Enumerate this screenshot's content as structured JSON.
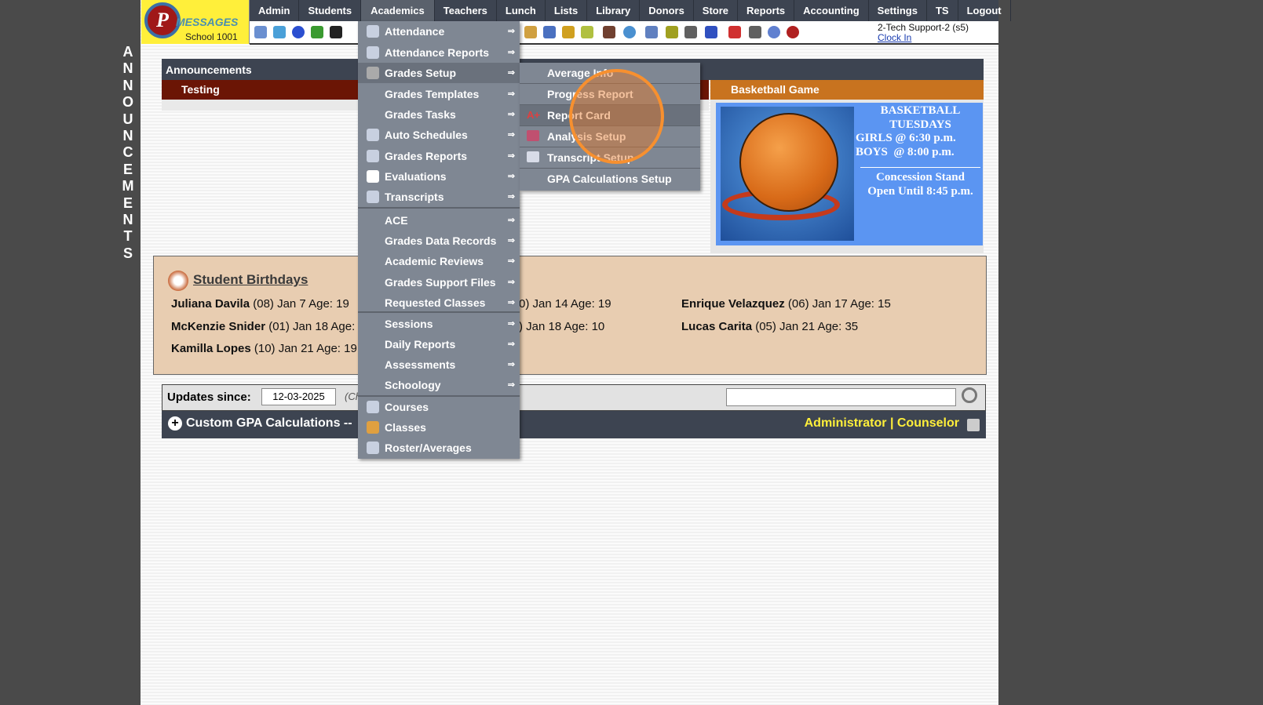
{
  "sidebar_vertical": "ANNOUNCEMENTS",
  "logo": {
    "letters": "P",
    "brand": "MESSAGES",
    "school": "School 1001"
  },
  "nav": [
    "Admin",
    "Students",
    "Academics",
    "Teachers",
    "Lunch",
    "Lists",
    "Library",
    "Donors",
    "Store",
    "Reports",
    "Accounting",
    "Settings",
    "TS",
    "Logout"
  ],
  "nav_active": "Academics",
  "toolbar_icons": [
    "search-icon",
    "calendar-icon",
    "email-icon",
    "chat-icon",
    "phone-icon",
    "burger-icon",
    "book-icon",
    "bell-icon",
    "export-icon",
    "person-icon",
    "alarm-icon",
    "calculator-icon",
    "card-icon",
    "printer-icon",
    "ap-icon",
    "pdf-icon",
    "cash-register-icon",
    "help-icon",
    "power-icon"
  ],
  "user": {
    "name": "2-Tech Support-2 (s5)",
    "clock": "Clock In"
  },
  "announcements": {
    "title": "Announcements",
    "item": "Testing"
  },
  "basketball": {
    "title": "Basketball Game",
    "l1": "BASKETBALL",
    "l2": "TUESDAYS",
    "l3": "GIRLS @ 6:30 p.m.",
    "l4": "BOYS  @ 8:00 p.m.",
    "l5": "Concession Stand",
    "l6": "Open Until 8:45 p.m."
  },
  "birthdays": {
    "title": "Student Birthdays",
    "rows": [
      {
        "name": "Juliana Davila",
        "info": "(08) Jan 7 Age: 19"
      },
      {
        "name": "McKenzie Snider",
        "info": "(01) Jan 18 Age:"
      },
      {
        "name": "Kamilla Lopes",
        "info": "(10) Jan 21 Age: 19"
      },
      {
        "name": "",
        "info": "0) Jan 14 Age: 19"
      },
      {
        "name": "",
        "info": ") Jan 18 Age: 10"
      },
      {
        "name": "Enrique Velazquez",
        "info": "(06) Jan 17 Age: 15"
      },
      {
        "name": "Lucas Carita",
        "info": "(05) Jan 21 Age: 35"
      }
    ]
  },
  "updates": {
    "label": "Updates since:",
    "date": "12-03-2025",
    "hint": "(Ch",
    "search_value": ""
  },
  "gpa_bar": {
    "title": "Custom GPA Calculations --",
    "roles": "Administrator | Counselor"
  },
  "menu": [
    {
      "label": "Attendance",
      "arrow": "⇒",
      "icon": "calendar-icon"
    },
    {
      "label": "Attendance Reports",
      "arrow": "⇒",
      "icon": "printer-icon"
    },
    {
      "label": "Grades Setup",
      "arrow": "⇒",
      "icon": "gear-icon",
      "active": true
    },
    {
      "label": "Grades Templates",
      "arrow": "⇒"
    },
    {
      "label": "Grades Tasks",
      "arrow": "⇒"
    },
    {
      "label": "Auto Schedules",
      "arrow": "⇒",
      "icon": "calendar-icon"
    },
    {
      "label": "Grades Reports",
      "arrow": "⇒",
      "icon": "printer-icon"
    },
    {
      "label": "Evaluations",
      "arrow": "⇒",
      "icon": "checkbox-icon"
    },
    {
      "label": "Transcripts",
      "arrow": "⇒",
      "icon": "document-icon"
    },
    {
      "label": "ACE",
      "arrow": "⇒"
    },
    {
      "label": "Grades Data Records",
      "arrow": "⇒"
    },
    {
      "label": "Academic Reviews",
      "arrow": "⇒"
    },
    {
      "label": "Grades Support Files",
      "arrow": "⇒"
    },
    {
      "label": "Requested Classes",
      "arrow": "⇒"
    },
    {
      "label": "Sessions",
      "arrow": "⇒"
    },
    {
      "label": "Daily Reports",
      "arrow": "⇒"
    },
    {
      "label": "Assessments",
      "arrow": "⇒"
    },
    {
      "label": "Schoology",
      "arrow": "⇒"
    },
    {
      "label": "Courses",
      "arrow": "",
      "icon": "book-icon"
    },
    {
      "label": "Classes",
      "arrow": "",
      "icon": "teacher-icon"
    },
    {
      "label": "Roster/Averages",
      "arrow": "",
      "icon": "roster-icon"
    }
  ],
  "submenu": [
    {
      "label": "Average Info"
    },
    {
      "label": "Progress Report"
    },
    {
      "label": "Report Card",
      "icon": "A+",
      "active": true
    },
    {
      "label": "Analysis Setup",
      "icon": "chart-icon"
    },
    {
      "label": "Transcript Setup",
      "icon": "document-icon"
    },
    {
      "label": "GPA Calculations Setup"
    }
  ],
  "colors": {
    "nav": "#3d4451",
    "menu": "#7f8793",
    "highlight_ring": "#f7902f",
    "logo_bg": "#ffef3a",
    "birthday_bg": "#e8cdb1",
    "basketball_header": "#c8731f"
  }
}
